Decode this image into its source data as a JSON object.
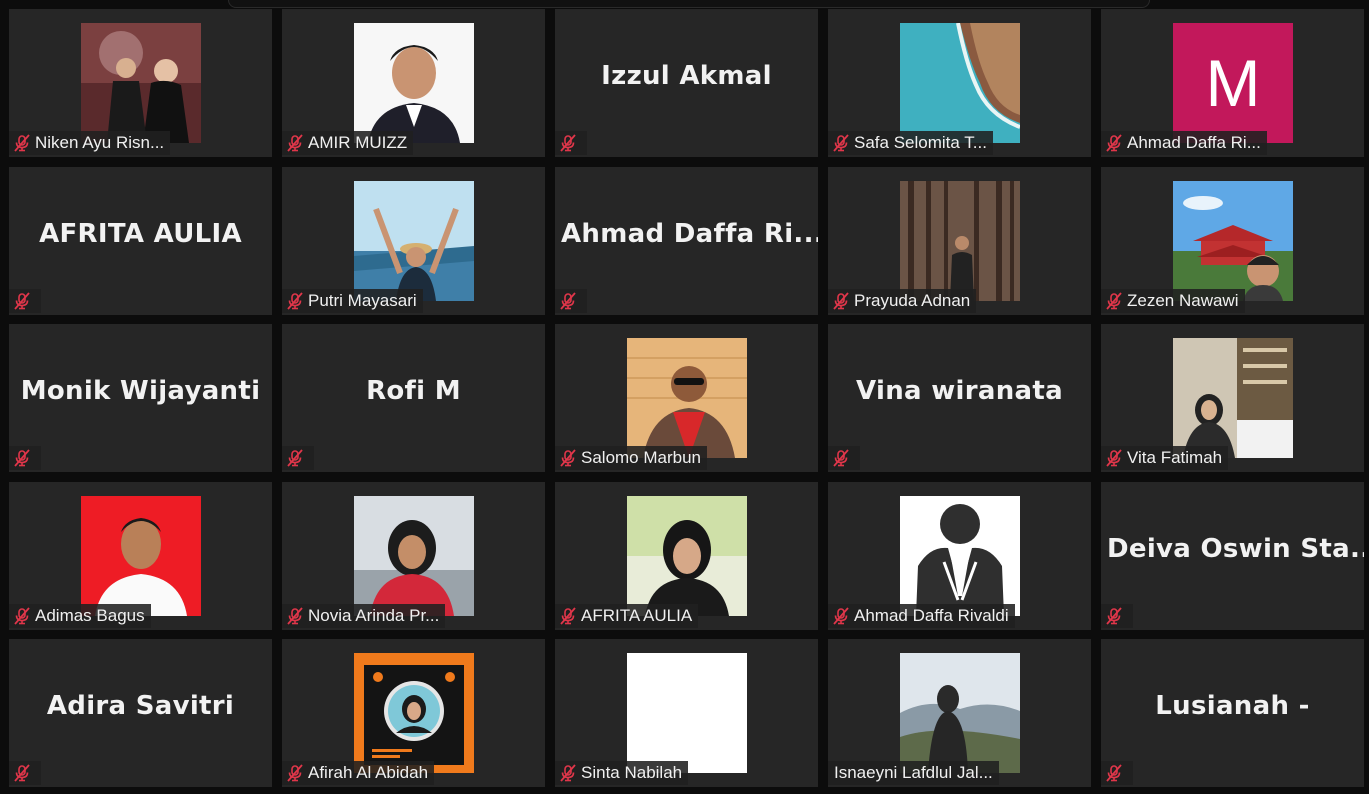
{
  "colors": {
    "background": "#0c0c0c",
    "tile": "#262626",
    "muted_mic": "#e0364a"
  },
  "participants": [
    {
      "label": "Niken Ayu Risn...",
      "display": "photo",
      "avatar": "photo-woman-stage"
    },
    {
      "label": "AMIR MUIZZ",
      "display": "photo",
      "avatar": "photo-man-suit"
    },
    {
      "label": "",
      "display": "name",
      "big_name": "Izzul Akmal"
    },
    {
      "label": "Safa Selomita T...",
      "display": "photo",
      "avatar": "photo-coast-aerial"
    },
    {
      "label": "Ahmad Daffa Ri...",
      "display": "photo",
      "avatar": "letter-avatar",
      "avatar_letter": "M",
      "avatar_color": "#c2185b"
    },
    {
      "label": "",
      "display": "name",
      "big_name": "AFRITA AULIA"
    },
    {
      "label": "Putri Mayasari",
      "display": "photo",
      "avatar": "photo-beach-woman"
    },
    {
      "label": "",
      "display": "name",
      "big_name": "Ahmad  Daffa  Ri..."
    },
    {
      "label": "Prayuda Adnan",
      "display": "photo",
      "avatar": "photo-forest-man"
    },
    {
      "label": "Zezen Nawawi",
      "display": "photo",
      "avatar": "photo-temple-selfie"
    },
    {
      "label": "",
      "display": "name",
      "big_name": "Monik Wijayanti"
    },
    {
      "label": "",
      "display": "name",
      "big_name": "Rofi M"
    },
    {
      "label": "Salomo Marbun",
      "display": "photo",
      "avatar": "photo-man-sunglasses"
    },
    {
      "label": "",
      "display": "name",
      "big_name": "Vina wiranata"
    },
    {
      "label": "Vita Fatimah",
      "display": "photo",
      "avatar": "photo-hijab-hall"
    },
    {
      "label": "Adimas Bagus",
      "display": "photo",
      "avatar": "photo-man-red-bg"
    },
    {
      "label": "Novia Arinda Pr...",
      "display": "photo",
      "avatar": "photo-hijab-red-jacket"
    },
    {
      "label": "AFRITA AULIA",
      "display": "photo",
      "avatar": "photo-hijab-black"
    },
    {
      "label": "Ahmad Daffa Rivaldi",
      "display": "photo",
      "avatar": "praying-hands-icon"
    },
    {
      "label": "",
      "display": "name",
      "big_name": "Deiva  Oswin  Sta..."
    },
    {
      "label": "",
      "display": "name",
      "big_name": "Adira Savitri"
    },
    {
      "label": "Afirah Al Abidah",
      "display": "photo",
      "avatar": "photo-poster-orange"
    },
    {
      "label": "Sinta Nabilah",
      "display": "photo",
      "avatar": "blank-white"
    },
    {
      "label": "Isnaeyni Lafdlul Jal...",
      "display": "photo",
      "avatar": "photo-hills-woman",
      "no_mic_icon": true
    },
    {
      "label": "",
      "display": "name",
      "big_name": "Lusianah -"
    }
  ]
}
